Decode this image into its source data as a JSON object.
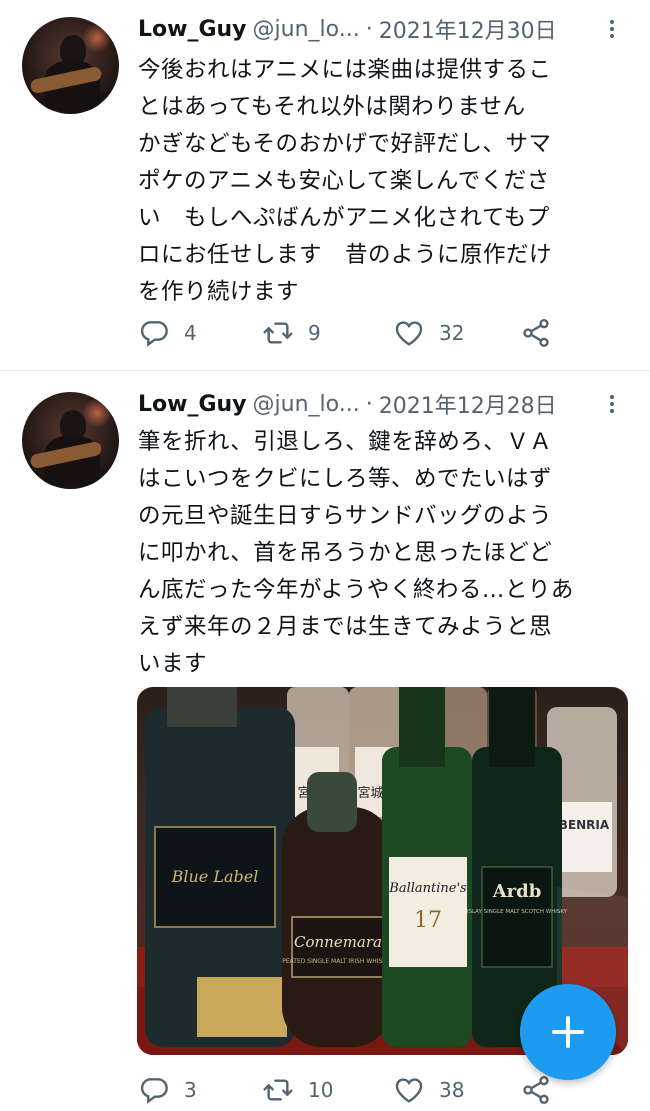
{
  "tweets": [
    {
      "name": "Low_Guy",
      "handle": "@jun_lo...",
      "dot": "·",
      "date": "2021年12月30日",
      "text": "今後おれはアニメには楽曲は提供するこ\nとはあってもそれ以外は関わりません\nかぎなどもそのおかげで好評だし、サマ\nポケのアニメも安心して楽しんでくださ\nい　もしへぷばんがアニメ化されてもプ\nロにお任せします　昔のように原作だけ\nを作り続けます",
      "replies": "4",
      "retweets": "9",
      "likes": "32"
    },
    {
      "name": "Low_Guy",
      "handle": "@jun_lo...",
      "dot": "·",
      "date": "2021年12月28日",
      "text": "筆を折れ、引退しろ、鍵を辞めろ、ＶＡ\nはこいつをクビにしろ等、めでたいはず\nの元旦や誕生日すらサンドバッグのよう\nに叩かれ、首を吊ろうかと思ったほどど\nん底だった今年がようやく終わる…とりあ\nえず来年の２月までは生きてみようと思\nいます",
      "replies": "3",
      "retweets": "10",
      "likes": "38",
      "photo": {
        "description_icon": "whisky-bottles-photo",
        "labels": {
          "blue_label": "Blue Label",
          "connemara": "Connemara",
          "connemara_sub": "PEATED SINGLE MALT IRISH WHISKEY",
          "ballantines": "Ballantine's",
          "ballantines_age": "17",
          "ardbeg": "Ardb",
          "ardbeg_sub": "ISLAY SINGLE MALT SCOTCH WHISKY",
          "benriach": "BENRIA",
          "miyagikyo": "宮城峡",
          "miyagikyo2": "宮城峡"
        }
      }
    }
  ],
  "icons": {
    "reply": "reply-icon",
    "retweet": "retweet-icon",
    "like": "heart-icon",
    "share": "share-icon",
    "more": "more-vertical-icon",
    "compose": "compose-plus-icon"
  },
  "colors": {
    "accent": "#1d9bf0",
    "muted": "#536471",
    "text": "#0f1419",
    "divider": "#e6ecf0"
  }
}
